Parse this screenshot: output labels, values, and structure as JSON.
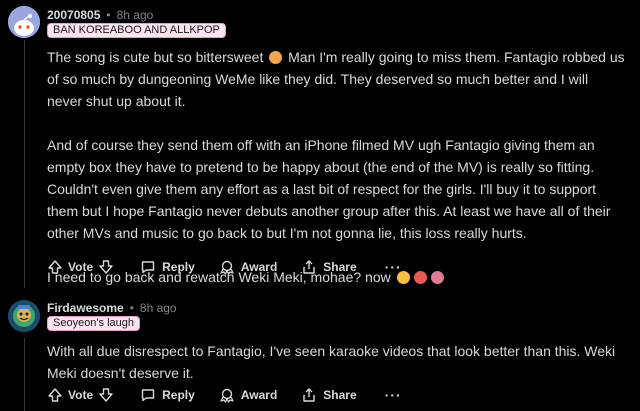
{
  "comments": [
    {
      "username": "20070805",
      "separator": "•",
      "time": "8h ago",
      "flair": "BAN KOREABOO AND ALLKPOP",
      "paragraphs": {
        "p1a": "The song is cute but so bittersweet",
        "p1b": "Man I'm really going to miss them. Fantagio robbed us of so much by dungeoning WeMe like they did. They deserved so much better and I will never shut up about it.",
        "p2": "And of course they send them off with an iPhone filmed MV ugh Fantagio giving them an empty box they have to pretend to be happy about (the end of the MV) is really so fitting. Couldn't even give them any effort as a last bit of respect for the girls. I'll buy it to support them but I hope Fantagio never debuts another group after this. At least we have all of their other MVs and music to go back to but I'm not gonna lie, this loss really hurts.",
        "p3": "I need to go back and rewatch Weki Meki, mohae? now"
      }
    },
    {
      "username": "Firdawesome",
      "separator": "•",
      "time": "8h ago",
      "flair": "Seoyeon's laugh",
      "paragraphs": {
        "p1": "With all due disrespect to Fantagio, I've seen karaoke videos that look better than this. Weki Meki doesn't deserve it."
      }
    }
  ],
  "actions": {
    "vote": "Vote",
    "reply": "Reply",
    "award": "Award",
    "share": "Share",
    "more": "···"
  },
  "colors": {
    "background": "#000000",
    "text": "#d7dadc",
    "muted": "#818384",
    "flair_bg": "#fbe3f0"
  }
}
